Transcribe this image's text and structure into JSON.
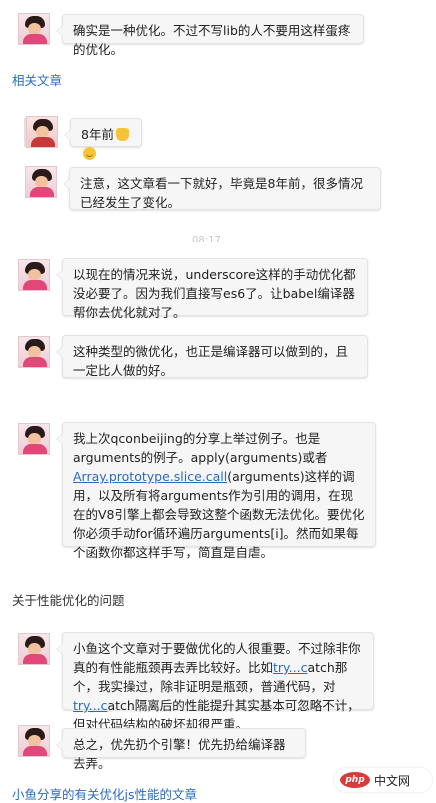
{
  "comments": [
    {
      "id": "c1",
      "text": "确实是一种优化。不过不写lib的人不要用这样蛋疼的优化。"
    },
    {
      "id": "c2",
      "text": "8年前",
      "emoji": [
        "thumbs-up-icon",
        "smile-icon"
      ]
    },
    {
      "id": "c3",
      "text": "注意，这文章看一下就好，毕竟是8年前，很多情况已经发生了变化。"
    },
    {
      "id": "c4",
      "text": "以现在的情况来说，underscore这样的手动优化都没必要了。因为我们直接写es6了。让babel编译器帮你去优化就对了。"
    },
    {
      "id": "c5",
      "text": "这种类型的微优化，也正是编译器可以做到的，且一定比人做的好。"
    },
    {
      "id": "c6",
      "text_before": "我上次qconbeijing的分享上举过例子。也是arguments的例子。apply(arguments)或者",
      "link": "Array.prototype.slice.call",
      "text_after": "(arguments)这样的调用，以及所有将arguments作为引用的调用，在现在的V8引擎上都会导致这整个函数无法优化。要优化你必须手动for循环遍历arguments[i]。然而如果每个函数你都这样手写，简直是自虐。"
    },
    {
      "id": "c7",
      "text_1": "小鱼这个文章对于要做优化的人很重要。不过除非你真的有性能瓶颈再去弄比较好。比如",
      "link_1": "try...c",
      "text_2": "atch那个，我实操过，除非证明是瓶颈，普通代码，对",
      "link_2": "try...c",
      "text_3": "atch隔离后的性能提升其实基本可忽略不计，但对代码结构的破坏却很严重。"
    },
    {
      "id": "c8",
      "text": "总之，优先扔个引擎！优先扔给编译器去弄。"
    }
  ],
  "sections": {
    "related": "相关文章",
    "perf_issues": "关于性能优化的问题",
    "xiaoyu_articles": "小鱼分享的有关优化js性能的文章"
  },
  "time_fragment": "08:17",
  "watermark": {
    "badge": "php",
    "text": "中文网"
  }
}
